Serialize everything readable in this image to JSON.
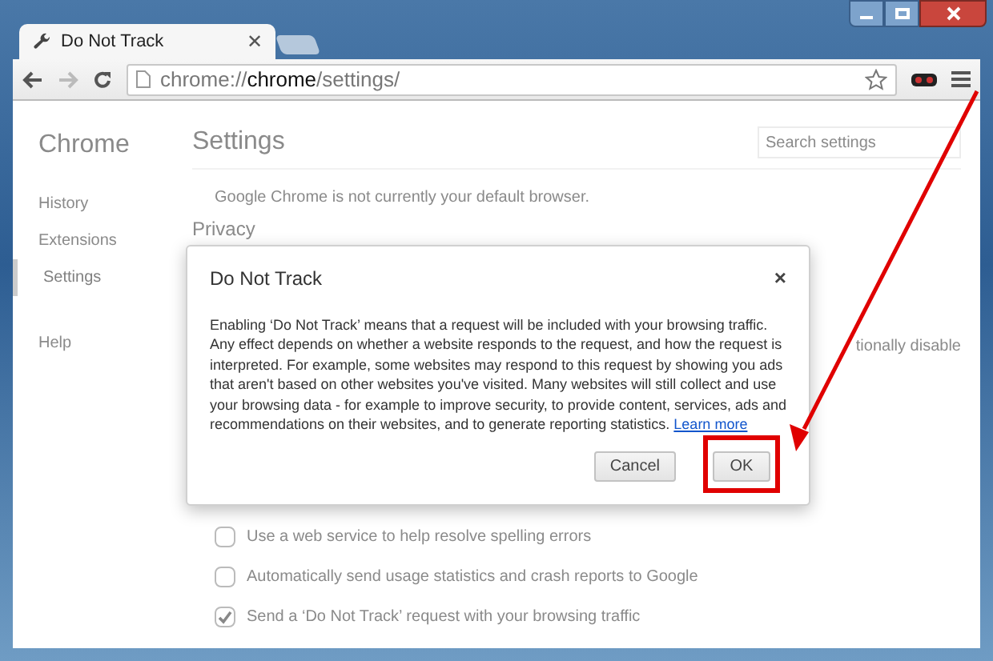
{
  "tabs": [
    {
      "title": "Do Not Track",
      "selected": true,
      "close": "✕"
    }
  ],
  "toolbar": {
    "back_disabled": false,
    "forward_disabled": true,
    "address": "chrome://**chrome**/settings/"
  },
  "sidebar": {
    "title": "Chrome",
    "items": [
      {
        "label": "History",
        "selected": false
      },
      {
        "label": "Extensions",
        "selected": false
      },
      {
        "label": "Settings",
        "selected": true
      },
      {
        "label": "Help",
        "selected": false
      }
    ]
  },
  "settings": {
    "title": "Settings",
    "search": {
      "placeholder": "Search settings"
    },
    "default_browser_note": "Google Chrome is not currently your default browser.",
    "section": "Privacy",
    "covered_fragment": "tionally disable",
    "options": [
      {
        "label": "Use a web service to help resolve spelling errors",
        "checked": false
      },
      {
        "label": "Automatically send usage statistics and crash reports to Google",
        "checked": false
      },
      {
        "label": "Send a ‘Do Not Track’ request with your browsing traffic",
        "checked": true
      }
    ]
  },
  "dialog": {
    "title": "Do Not Track",
    "close": "×",
    "body": "Enabling ‘Do Not Track’ means that a request will be included with your browsing traffic. Any effect depends on whether a website responds to the request, and how the request is interpreted. For example, some websites may respond to this request by showing you ads that aren't based on other websites you've visited. Many websites will still collect and use your browsing data - for example to improve security, to provide content, services, ads and recommendations on their websites, and to generate reporting statistics.",
    "link": "Learn more",
    "buttons": [
      {
        "label": "Cancel",
        "highlighted": false
      },
      {
        "label": "OK",
        "highlighted": true
      }
    ]
  }
}
